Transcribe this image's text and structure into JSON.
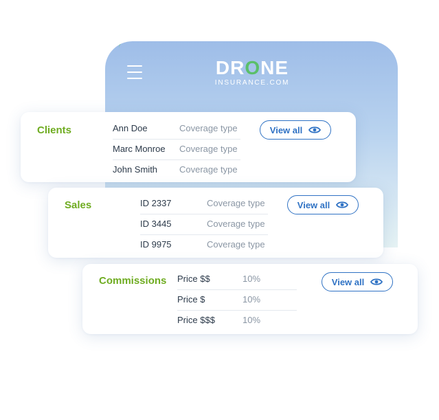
{
  "header": {
    "logo_text": "DRONE",
    "logo_subtext": "INSURANCE.COM"
  },
  "colors": {
    "accent_green": "#6fac21",
    "link_blue": "#2f72c4"
  },
  "cards": {
    "clients": {
      "title": "Clients",
      "button_label": "View all",
      "rows": [
        {
          "name": "Ann Doe",
          "coverage": "Coverage type"
        },
        {
          "name": "Marc Monroe",
          "coverage": "Coverage type"
        },
        {
          "name": "John Smith",
          "coverage": "Coverage type"
        }
      ]
    },
    "sales": {
      "title": "Sales",
      "button_label": "View all",
      "rows": [
        {
          "id": "ID 2337",
          "coverage": "Coverage type"
        },
        {
          "id": "ID 3445",
          "coverage": "Coverage type"
        },
        {
          "id": "ID 9975",
          "coverage": "Coverage type"
        }
      ]
    },
    "commissions": {
      "title": "Commissions",
      "button_label": "View all",
      "rows": [
        {
          "price": "Price $$",
          "rate": "10%"
        },
        {
          "price": "Price $",
          "rate": "10%"
        },
        {
          "price": "Price $$$",
          "rate": "10%"
        }
      ]
    }
  }
}
